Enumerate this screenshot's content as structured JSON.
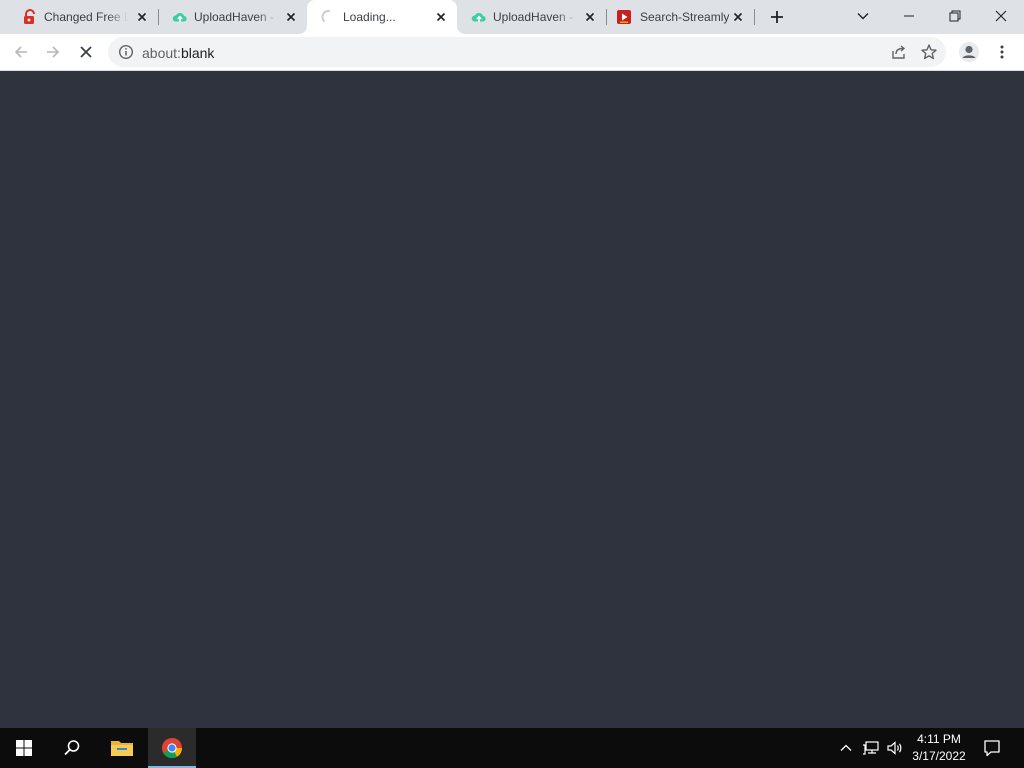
{
  "browser": {
    "tabs": [
      {
        "title": "Changed Free D",
        "favicon": "lock-icon",
        "active": false
      },
      {
        "title": "UploadHaven -",
        "favicon": "upload-cloud-icon",
        "active": false
      },
      {
        "title": "Loading...",
        "favicon": "loading-spinner-icon",
        "active": true
      },
      {
        "title": "UploadHaven -",
        "favicon": "upload-cloud-icon",
        "active": false
      },
      {
        "title": "Search-Streamly",
        "favicon": "streamly-icon",
        "active": false
      }
    ],
    "address": {
      "value": "about:blank",
      "scheme": "about:",
      "rest": "blank"
    },
    "state": "loading"
  },
  "page": {
    "background": "#2f333d"
  },
  "taskbar": {
    "apps": [
      "start-icon",
      "search-icon",
      "file-explorer-icon",
      "chrome-icon"
    ],
    "active_app": "chrome",
    "clock": {
      "time": "4:11 PM",
      "date": "3/17/2022"
    }
  },
  "colors": {
    "tabstrip": "#dee1e6",
    "toolbar": "#ffffff",
    "taskbar": "#0c0c0c",
    "accent": "#76b9ed"
  }
}
